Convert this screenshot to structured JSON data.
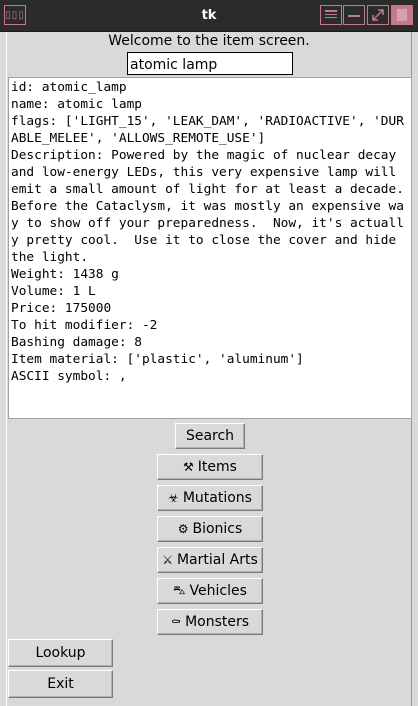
{
  "window": {
    "title": "tk"
  },
  "header": {
    "welcome": "Welcome to the item screen.",
    "search_value": "atomic lamp"
  },
  "details": [
    "id: atomic_lamp",
    "name: atomic lamp",
    "flags: ['LIGHT_15', 'LEAK_DAM', 'RADIOACTIVE', 'DURABLE_MELEE', 'ALLOWS_REMOTE_USE']",
    "Description: Powered by the magic of nuclear decay and low-energy LEDs, this very expensive lamp will emit a small amount of light for at least a decade.  Before the Cataclysm, it was mostly an expensive way to show off your preparedness.  Now, it's actually pretty cool.  Use it to close the cover and hide the light.",
    "Weight: 1438 g",
    "Volume: 1 L",
    "Price: 175000",
    "To hit modifier: -2",
    "Bashing damage: 8",
    "Item material: ['plastic', 'aluminum']",
    "ASCII symbol: ,"
  ],
  "buttons": {
    "search": "Search",
    "items": "Items",
    "mutations": "Mutations",
    "bionics": "Bionics",
    "martial_arts": "Martial Arts",
    "vehicles": "Vehicles",
    "monsters": "Monsters",
    "lookup": "Lookup",
    "exit": "Exit"
  },
  "icons": {
    "items": "⚒",
    "mutations": "☣",
    "bionics": "⚙",
    "martial_arts": "⚔",
    "vehicles": "⛍",
    "monsters": "⚰"
  },
  "colors": {
    "titlebar": "#2b2b2b",
    "accent": "#c07a8a",
    "window_bg": "#d9d9d9"
  }
}
